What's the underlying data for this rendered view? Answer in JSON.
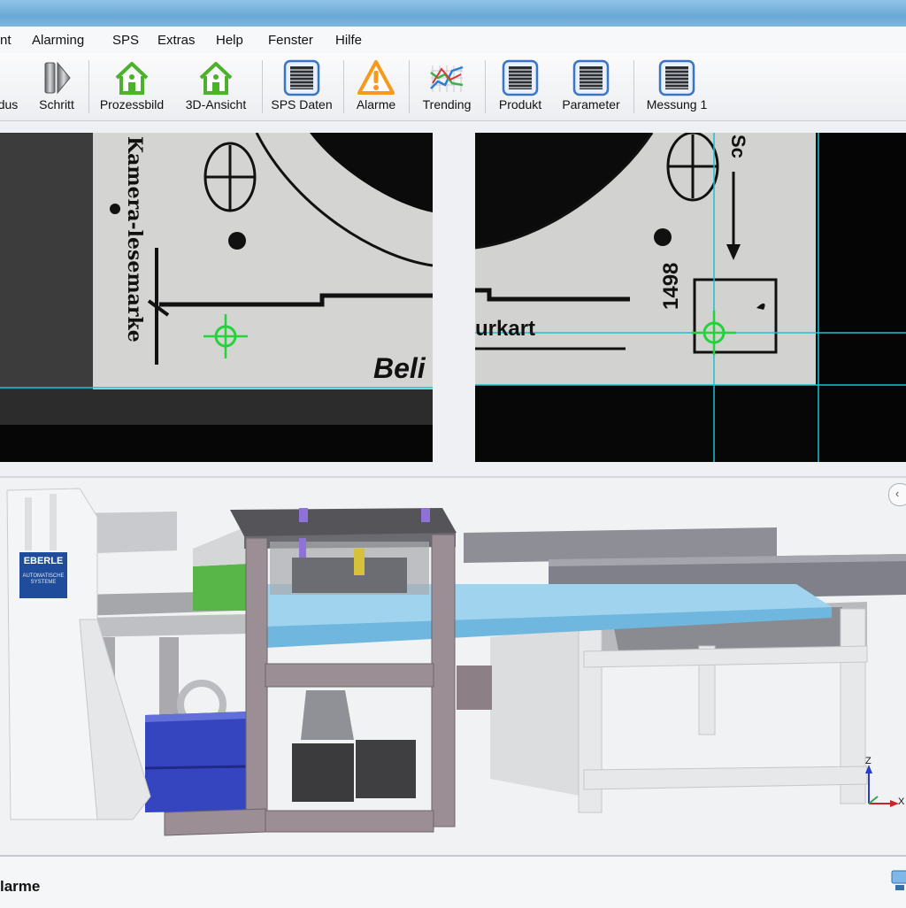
{
  "menu": {
    "items": [
      {
        "label": "nt"
      },
      {
        "label": "Alarming"
      },
      {
        "label": "SPS"
      },
      {
        "label": "Extras"
      },
      {
        "label": "Help"
      },
      {
        "label": "Fenster"
      },
      {
        "label": "Hilfe"
      }
    ]
  },
  "toolbar": {
    "modus": "dus",
    "schritt": "Schritt",
    "prozessbild": "Prozessbild",
    "ansicht3d": "3D-Ansicht",
    "sps_daten": "SPS Daten",
    "alarme": "Alarme",
    "trending": "Trending",
    "produkt": "Produkt",
    "parameter": "Parameter",
    "messung": "Messung 1"
  },
  "camera_left": {
    "label_line1": "Kamera-",
    "label_line2": "lesemarke",
    "text_bottom": "Beli"
  },
  "camera_right": {
    "label_number": "1498",
    "label_top": "Sc",
    "label_mid": "urkart"
  },
  "viewer3d": {
    "brand_label": "EBERLE",
    "brand_sub": "AUTOMATISCHE SYSTEME",
    "axis_z": "Z",
    "axis_x": "X"
  },
  "status": {
    "label": "larme"
  },
  "colors": {
    "crosshair": "#22d33a",
    "guide_line": "#17c3cf",
    "home_icon": "#4cb22c",
    "alarm_icon": "#f39a1f",
    "list_icon_border": "#3a74c4"
  }
}
